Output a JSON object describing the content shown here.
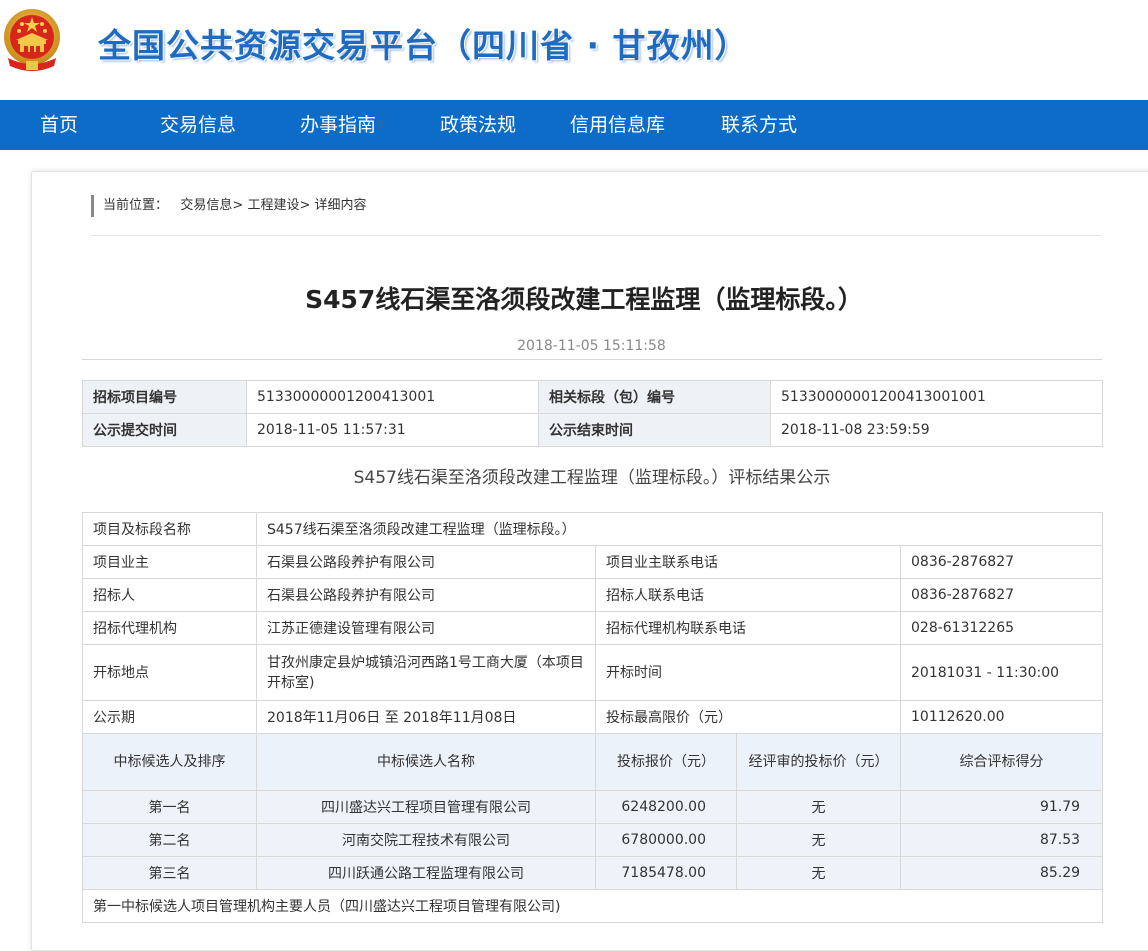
{
  "site": {
    "title": "全国公共资源交易平台（四川省 · 甘孜州）",
    "brand_color": "#0c6cc8",
    "title_color": "#1f6bc2",
    "emblem_icon": "national-emblem-icon"
  },
  "nav": {
    "items": [
      "首页",
      "交易信息",
      "办事指南",
      "政策法规",
      "信用信息库",
      "联系方式"
    ]
  },
  "breadcrumb": {
    "prefix": "当前位置：",
    "items": [
      "交易信息>",
      "工程建设>",
      "详细内容"
    ]
  },
  "article": {
    "title": "S457线石渠至洛须段改建工程监理（监理标段。）",
    "publish_time": "2018-11-05 15:11:58"
  },
  "info_table": {
    "rows": [
      [
        "招标项目编号",
        "51330000001200413001",
        "相关标段（包）编号",
        "51330000001200413001001"
      ],
      [
        "公示提交时间",
        "2018-11-05 11:57:31",
        "公示结束时间",
        "2018-11-08 23:59:59"
      ]
    ]
  },
  "result": {
    "heading": "S457线石渠至洛须段改建工程监理（监理标段。）评标结果公示",
    "project_name_label": "项目及标段名称",
    "project_name": "S457线石渠至洛须段改建工程监理（监理标段。）",
    "details": [
      [
        "项目业主",
        "石渠县公路段养护有限公司",
        "项目业主联系电话",
        "0836-2876827"
      ],
      [
        "招标人",
        "石渠县公路段养护有限公司",
        "招标人联系电话",
        "0836-2876827"
      ],
      [
        "招标代理机构",
        "江苏正德建设管理有限公司",
        "招标代理机构联系电话",
        "028-61312265"
      ],
      [
        "开标地点",
        "甘孜州康定县炉城镇沿河西路1号工商大厦（本项目开标室)",
        "开标时间",
        "20181031 - 11:30:00"
      ],
      [
        "公示期",
        "2018年11月06日 至 2018年11月08日",
        "投标最高限价（元）",
        "10112620.00"
      ]
    ],
    "candidate_headers": [
      "中标候选人及排序",
      "中标候选人名称",
      "投标报价（元）",
      "经评审的投标价（元）",
      "综合评标得分"
    ],
    "candidates": [
      [
        "第一名",
        "四川盛达兴工程项目管理有限公司",
        "6248200.00",
        "无",
        "91.79"
      ],
      [
        "第二名",
        "河南交院工程技术有限公司",
        "6780000.00",
        "无",
        "87.53"
      ],
      [
        "第三名",
        "四川跃通公路工程监理有限公司",
        "7185478.00",
        "无",
        "85.29"
      ]
    ],
    "footer_note": "第一中标候选人项目管理机构主要人员（四川盛达兴工程项目管理有限公司)"
  }
}
